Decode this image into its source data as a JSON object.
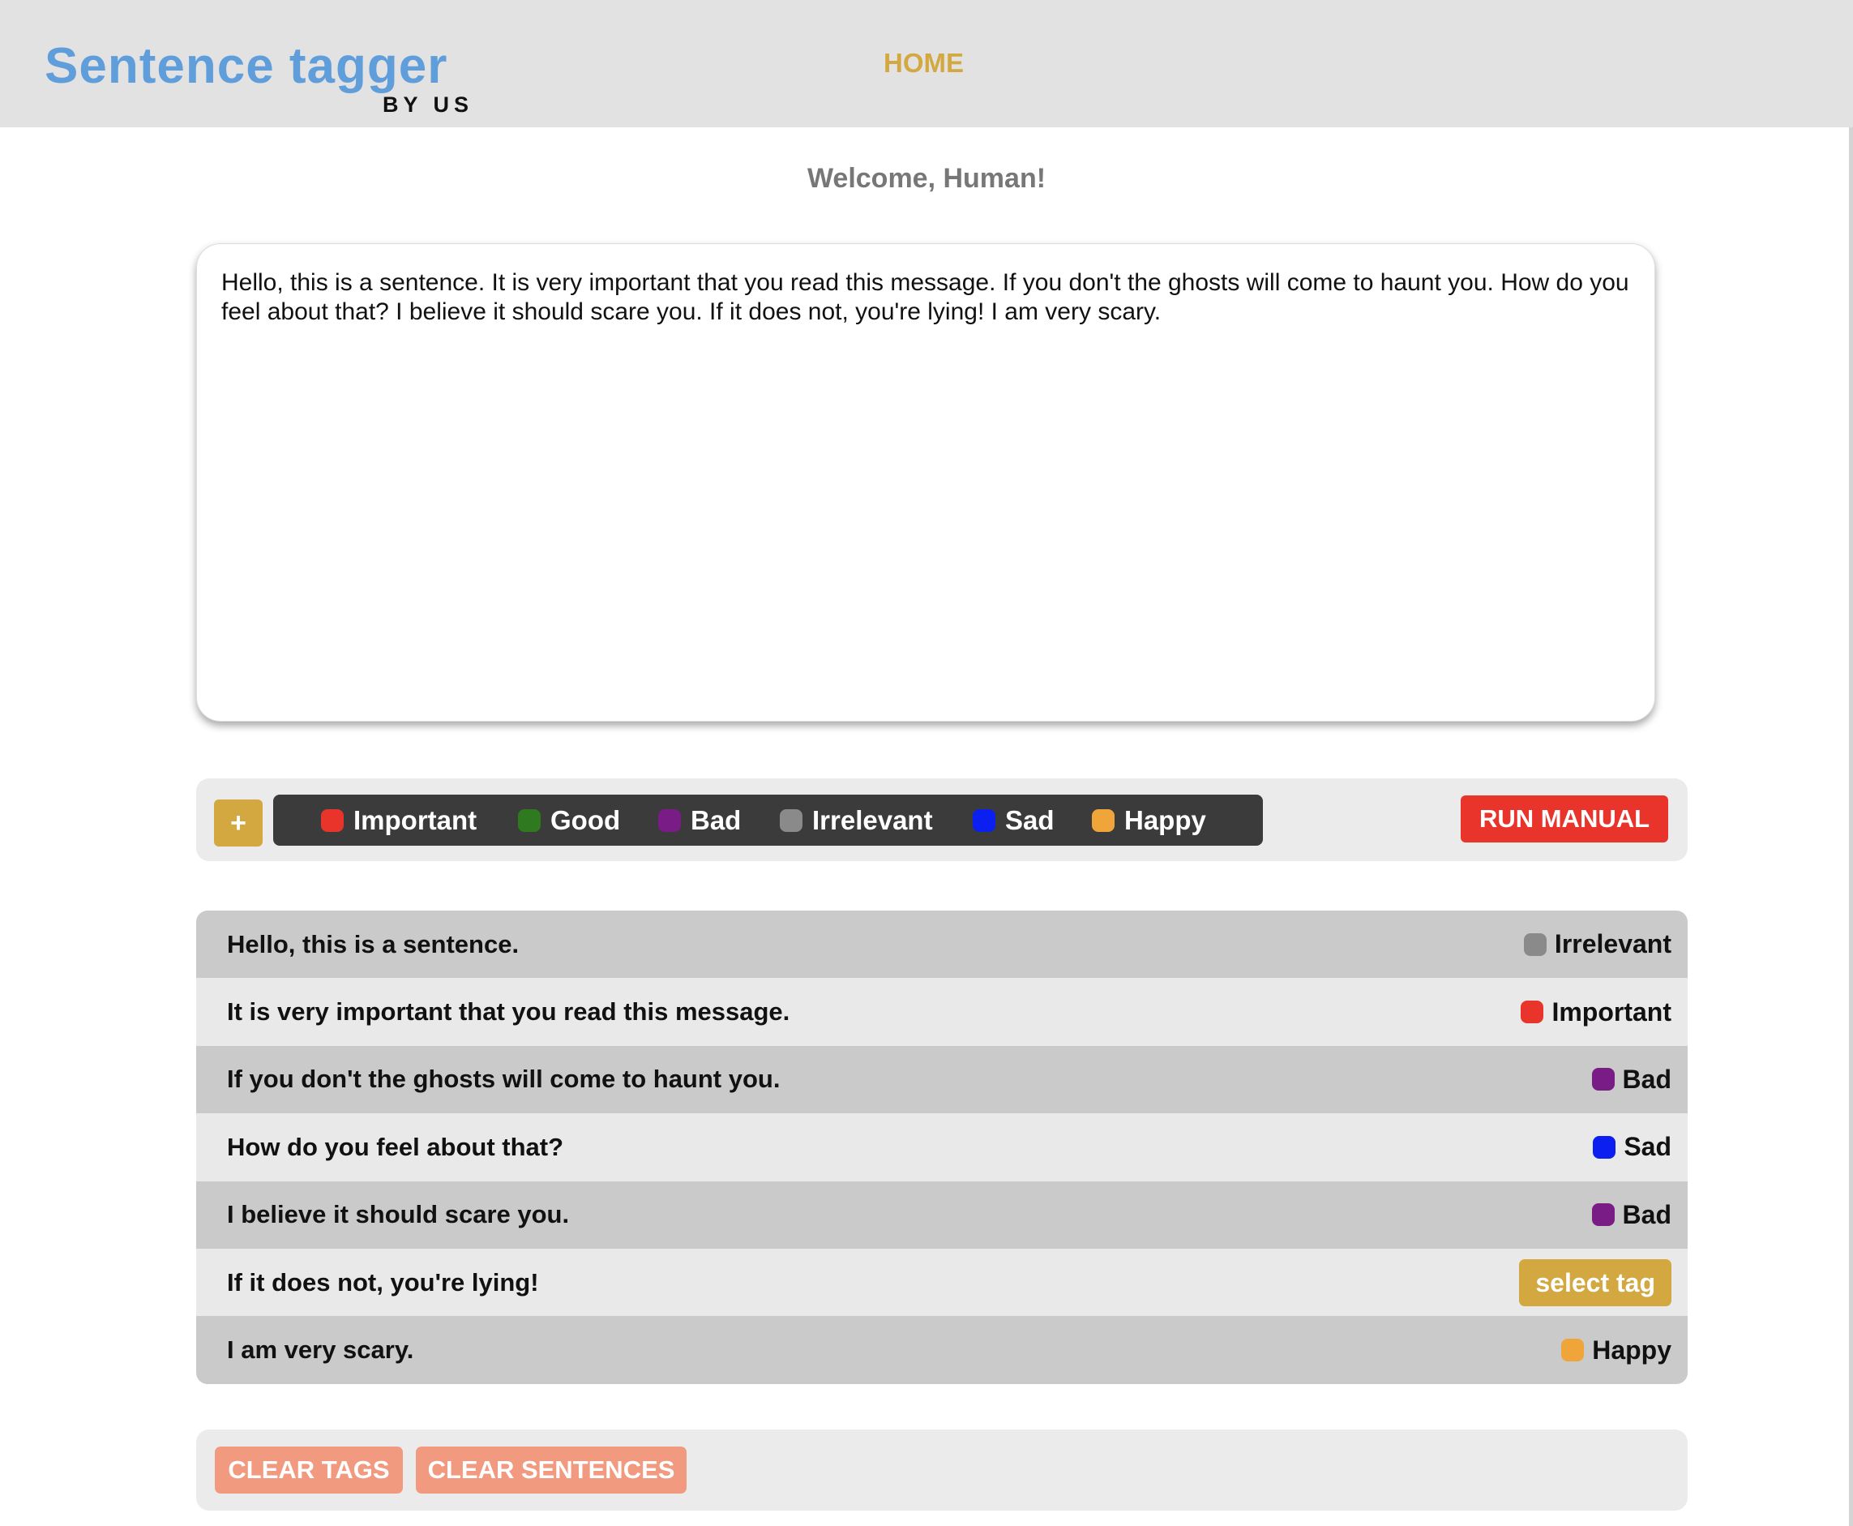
{
  "header": {
    "logo_title": "Sentence tagger",
    "logo_subtitle": "BY US",
    "nav_home": "HOME"
  },
  "welcome": "Welcome, Human!",
  "input_text": "Hello, this is a sentence. It is very important that you read this message. If you don't the ghosts will come to haunt you. How do you feel about that? I believe it should scare you. If it does not, you're lying! I am very scary.",
  "toolbar": {
    "add_label": "+",
    "tags": [
      {
        "label": "Important",
        "color": "#e8342a"
      },
      {
        "label": "Good",
        "color": "#2f7a1f"
      },
      {
        "label": "Bad",
        "color": "#7a1c85"
      },
      {
        "label": "Irrelevant",
        "color": "#8a8a8a"
      },
      {
        "label": "Sad",
        "color": "#0a1ff0"
      },
      {
        "label": "Happy",
        "color": "#f0a53b"
      }
    ],
    "run_label": "RUN MANUAL"
  },
  "sentences": [
    {
      "text": "Hello, this is a sentence.",
      "tag": "Irrelevant",
      "tag_color": "#8a8a8a"
    },
    {
      "text": "It is very important that you read this message.",
      "tag": "Important",
      "tag_color": "#e8342a"
    },
    {
      "text": "If you don't the ghosts will come to haunt you.",
      "tag": "Bad",
      "tag_color": "#7a1c85"
    },
    {
      "text": "How do you feel about that?",
      "tag": "Sad",
      "tag_color": "#0a1ff0"
    },
    {
      "text": "I believe it should scare you.",
      "tag": "Bad",
      "tag_color": "#7a1c85"
    },
    {
      "text": "If it does not, you're lying!",
      "tag": "",
      "select_label": "select tag"
    },
    {
      "text": "I am very scary.",
      "tag": "Happy",
      "tag_color": "#f0a53b"
    }
  ],
  "footer": {
    "clear_tags_label": "CLEAR TAGS",
    "clear_sentences_label": "CLEAR SENTENCES"
  }
}
